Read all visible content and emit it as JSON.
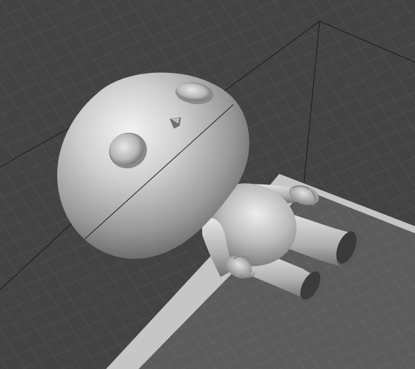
{
  "viewport": {
    "type": "3d-model-viewport",
    "scene": {
      "model": "chibi-figure-mesh",
      "shading": "grey-matte",
      "grid": true,
      "build_plate": true,
      "bounding_box": true
    },
    "colors": {
      "background": "#434343",
      "grid_fine": "#5a5a5a",
      "grid_major": "#6a6a6a",
      "plate_frame": "#c4c4c4",
      "plate_surface": "#5b5b5b",
      "bbox_line": "#1a1a1a",
      "model_base": "#bdbdbd",
      "model_highlight": "#efefef",
      "model_shadow": "#5e5e5e"
    }
  }
}
